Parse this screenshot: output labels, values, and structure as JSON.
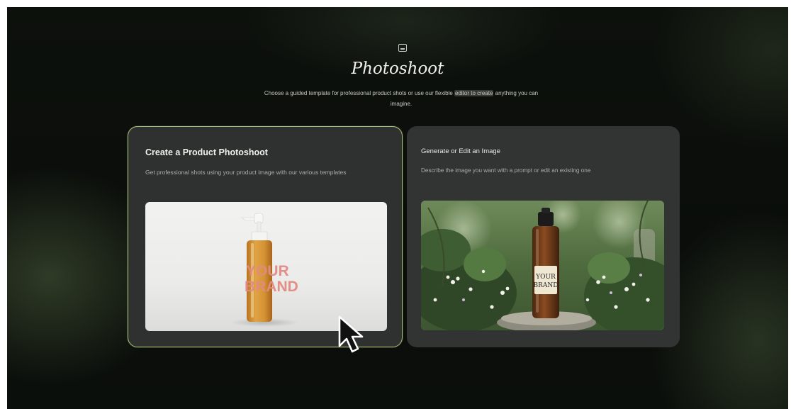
{
  "header": {
    "icon": "image-icon",
    "title": "Photoshoot",
    "subtitle_part1": "Choose a guided template for professional product shots or use our flexible ",
    "subtitle_highlight": "editor to create",
    "subtitle_part2": " anything you can imagine."
  },
  "cards": [
    {
      "title": "Create a Product Photoshoot",
      "description": "Get professional shots using your product image with our various templates",
      "selected": true,
      "image_brand_text": "YOUR BRAND"
    },
    {
      "title": "Generate or Edit an Image",
      "description": "Describe the image you want with a prompt or edit an existing one",
      "selected": false,
      "image_brand_line1": "YOUR",
      "image_brand_line2": "BRAND"
    }
  ],
  "colors": {
    "accent_border": "#a9c27a",
    "card_bg": "#2f3130",
    "bottle_amber": "#d99a3a",
    "label_pink": "#e38a82"
  }
}
